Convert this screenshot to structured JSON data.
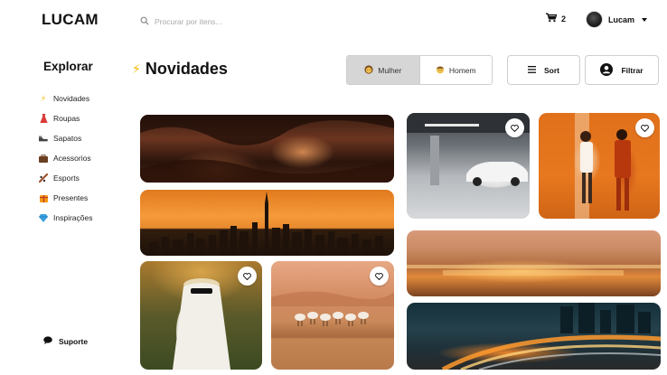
{
  "header": {
    "logo": "LUCAM",
    "search_placeholder": "Procurar por itens...",
    "cart_count": "2",
    "user_name": "Lucam"
  },
  "sidebar": {
    "title": "Explorar",
    "items": [
      {
        "label": "Novidades",
        "icon": "lightning-icon"
      },
      {
        "label": "Roupas",
        "icon": "dress-icon"
      },
      {
        "label": "Sapatos",
        "icon": "shoe-icon"
      },
      {
        "label": "Acessorios",
        "icon": "bag-icon"
      },
      {
        "label": "Esports",
        "icon": "skate-icon"
      },
      {
        "label": "Presentes",
        "icon": "gift-icon"
      },
      {
        "label": "Inspirações",
        "icon": "diamond-icon"
      }
    ],
    "support_label": "Suporte"
  },
  "main": {
    "title": "Novidades",
    "gender_toggle": [
      {
        "label": "Mulher",
        "active": true
      },
      {
        "label": "Homem",
        "active": false
      }
    ],
    "sort_label": "Sort",
    "filter_label": "Filtrar"
  },
  "colors": {
    "accent_bolt": "#f5b800",
    "active_toggle_bg": "#d6d6d6",
    "border": "#cfcfcf"
  }
}
